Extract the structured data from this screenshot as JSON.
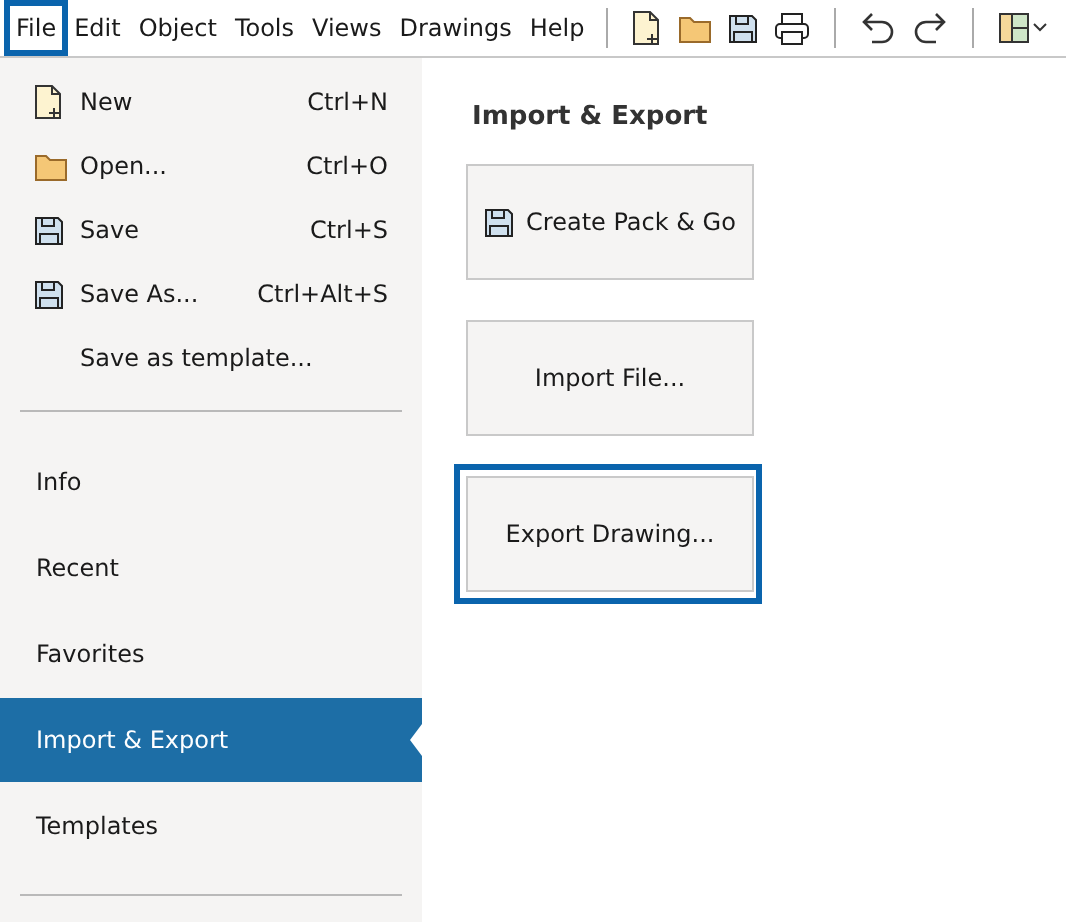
{
  "menu_bar": {
    "menus": [
      {
        "label": "File",
        "highlighted": true
      },
      {
        "label": "Edit",
        "highlighted": false
      },
      {
        "label": "Object",
        "highlighted": false
      },
      {
        "label": "Tools",
        "highlighted": false
      },
      {
        "label": "Views",
        "highlighted": false
      },
      {
        "label": "Drawings",
        "highlighted": false
      },
      {
        "label": "Help",
        "highlighted": false
      }
    ],
    "toolbar": [
      {
        "kind": "new"
      },
      {
        "kind": "open"
      },
      {
        "kind": "save"
      },
      {
        "kind": "print"
      },
      {
        "kind": "sep"
      },
      {
        "kind": "undo"
      },
      {
        "kind": "redo"
      },
      {
        "kind": "sep"
      },
      {
        "kind": "layout"
      }
    ]
  },
  "sidebar": {
    "commands": [
      {
        "kind": "new",
        "label": "New",
        "shortcut": "Ctrl+N"
      },
      {
        "kind": "open",
        "label": "Open...",
        "shortcut": "Ctrl+O"
      },
      {
        "kind": "save",
        "label": "Save",
        "shortcut": "Ctrl+S"
      },
      {
        "kind": "save",
        "label": "Save As...",
        "shortcut": "Ctrl+Alt+S"
      },
      {
        "kind": "none",
        "label": "Save as template..."
      }
    ],
    "items": [
      {
        "label": "Info",
        "selected": false
      },
      {
        "label": "Recent",
        "selected": false
      },
      {
        "label": "Favorites",
        "selected": false
      },
      {
        "label": "Import & Export",
        "selected": true
      },
      {
        "label": "Templates",
        "selected": false
      }
    ]
  },
  "content": {
    "title": "Import & Export",
    "buttons": [
      {
        "kind": "save",
        "label": "Create Pack & Go",
        "highlighted": false
      },
      {
        "kind": "none",
        "label": "Import File...",
        "highlighted": false
      },
      {
        "kind": "none",
        "label": "Export Drawing...",
        "highlighted": true
      }
    ]
  }
}
